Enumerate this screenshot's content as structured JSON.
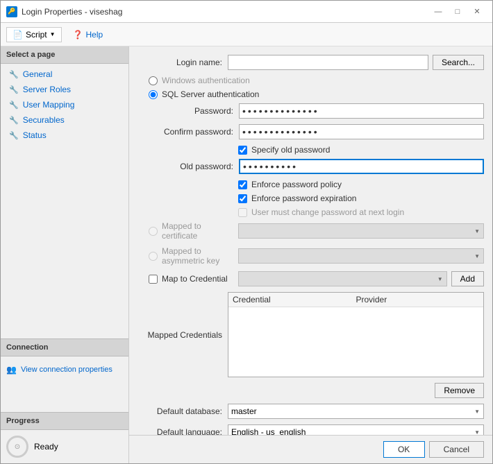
{
  "window": {
    "title": "Login Properties - viseshag",
    "icon": "🔑"
  },
  "titlebar": {
    "minimize": "—",
    "maximize": "□",
    "close": "✕"
  },
  "toolbar": {
    "script_label": "Script",
    "help_label": "Help"
  },
  "sidebar": {
    "select_page": "Select a page",
    "items": [
      {
        "label": "General",
        "icon": "🔧"
      },
      {
        "label": "Server Roles",
        "icon": "🔧"
      },
      {
        "label": "User Mapping",
        "icon": "🔧"
      },
      {
        "label": "Securables",
        "icon": "🔧"
      },
      {
        "label": "Status",
        "icon": "🔧"
      }
    ],
    "connection_label": "Connection",
    "connection_link": "View connection properties",
    "progress_label": "Progress",
    "progress_status": "Ready"
  },
  "form": {
    "login_name_label": "Login name:",
    "search_btn": "Search...",
    "windows_auth_label": "Windows authentication",
    "sql_auth_label": "SQL Server authentication",
    "password_label": "Password:",
    "password_value": "••••••••••••••",
    "confirm_password_label": "Confirm password:",
    "confirm_password_value": "••••••••••••••",
    "specify_old_password_label": "Specify old password",
    "old_password_label": "Old password:",
    "old_password_value": "••••••••••",
    "enforce_policy_label": "Enforce password policy",
    "enforce_expiration_label": "Enforce password expiration",
    "must_change_password_label": "User must change password at next login",
    "mapped_certificate_label": "Mapped to certificate",
    "mapped_asymmetric_label": "Mapped to asymmetric key",
    "map_credential_label": "Map to Credential",
    "add_btn": "Add",
    "mapped_credentials_label": "Mapped Credentials",
    "credential_col": "Credential",
    "provider_col": "Provider",
    "remove_btn": "Remove",
    "default_database_label": "Default database:",
    "default_database_value": "master",
    "default_language_label": "Default language:",
    "default_language_value": "English - us_english"
  },
  "buttons": {
    "ok": "OK",
    "cancel": "Cancel"
  }
}
